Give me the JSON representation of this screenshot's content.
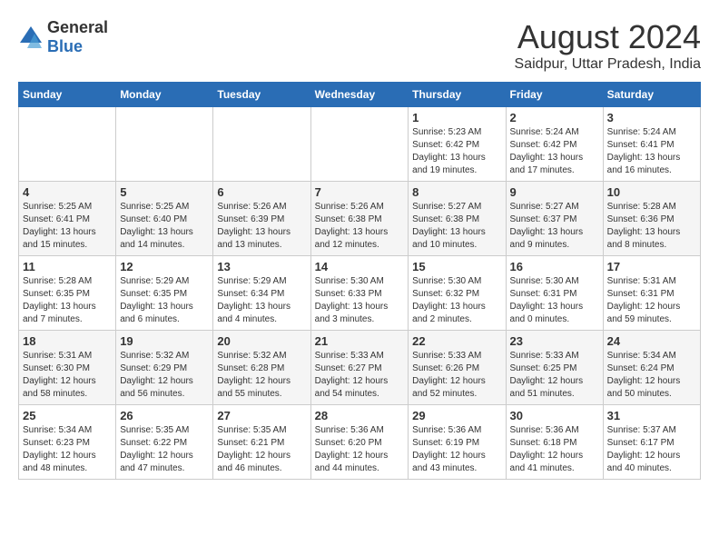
{
  "logo": {
    "text_general": "General",
    "text_blue": "Blue"
  },
  "title": "August 2024",
  "subtitle": "Saidpur, Uttar Pradesh, India",
  "weekdays": [
    "Sunday",
    "Monday",
    "Tuesday",
    "Wednesday",
    "Thursday",
    "Friday",
    "Saturday"
  ],
  "weeks": [
    [
      {
        "day": "",
        "info": ""
      },
      {
        "day": "",
        "info": ""
      },
      {
        "day": "",
        "info": ""
      },
      {
        "day": "",
        "info": ""
      },
      {
        "day": "1",
        "info": "Sunrise: 5:23 AM\nSunset: 6:42 PM\nDaylight: 13 hours\nand 19 minutes."
      },
      {
        "day": "2",
        "info": "Sunrise: 5:24 AM\nSunset: 6:42 PM\nDaylight: 13 hours\nand 17 minutes."
      },
      {
        "day": "3",
        "info": "Sunrise: 5:24 AM\nSunset: 6:41 PM\nDaylight: 13 hours\nand 16 minutes."
      }
    ],
    [
      {
        "day": "4",
        "info": "Sunrise: 5:25 AM\nSunset: 6:41 PM\nDaylight: 13 hours\nand 15 minutes."
      },
      {
        "day": "5",
        "info": "Sunrise: 5:25 AM\nSunset: 6:40 PM\nDaylight: 13 hours\nand 14 minutes."
      },
      {
        "day": "6",
        "info": "Sunrise: 5:26 AM\nSunset: 6:39 PM\nDaylight: 13 hours\nand 13 minutes."
      },
      {
        "day": "7",
        "info": "Sunrise: 5:26 AM\nSunset: 6:38 PM\nDaylight: 13 hours\nand 12 minutes."
      },
      {
        "day": "8",
        "info": "Sunrise: 5:27 AM\nSunset: 6:38 PM\nDaylight: 13 hours\nand 10 minutes."
      },
      {
        "day": "9",
        "info": "Sunrise: 5:27 AM\nSunset: 6:37 PM\nDaylight: 13 hours\nand 9 minutes."
      },
      {
        "day": "10",
        "info": "Sunrise: 5:28 AM\nSunset: 6:36 PM\nDaylight: 13 hours\nand 8 minutes."
      }
    ],
    [
      {
        "day": "11",
        "info": "Sunrise: 5:28 AM\nSunset: 6:35 PM\nDaylight: 13 hours\nand 7 minutes."
      },
      {
        "day": "12",
        "info": "Sunrise: 5:29 AM\nSunset: 6:35 PM\nDaylight: 13 hours\nand 6 minutes."
      },
      {
        "day": "13",
        "info": "Sunrise: 5:29 AM\nSunset: 6:34 PM\nDaylight: 13 hours\nand 4 minutes."
      },
      {
        "day": "14",
        "info": "Sunrise: 5:30 AM\nSunset: 6:33 PM\nDaylight: 13 hours\nand 3 minutes."
      },
      {
        "day": "15",
        "info": "Sunrise: 5:30 AM\nSunset: 6:32 PM\nDaylight: 13 hours\nand 2 minutes."
      },
      {
        "day": "16",
        "info": "Sunrise: 5:30 AM\nSunset: 6:31 PM\nDaylight: 13 hours\nand 0 minutes."
      },
      {
        "day": "17",
        "info": "Sunrise: 5:31 AM\nSunset: 6:31 PM\nDaylight: 12 hours\nand 59 minutes."
      }
    ],
    [
      {
        "day": "18",
        "info": "Sunrise: 5:31 AM\nSunset: 6:30 PM\nDaylight: 12 hours\nand 58 minutes."
      },
      {
        "day": "19",
        "info": "Sunrise: 5:32 AM\nSunset: 6:29 PM\nDaylight: 12 hours\nand 56 minutes."
      },
      {
        "day": "20",
        "info": "Sunrise: 5:32 AM\nSunset: 6:28 PM\nDaylight: 12 hours\nand 55 minutes."
      },
      {
        "day": "21",
        "info": "Sunrise: 5:33 AM\nSunset: 6:27 PM\nDaylight: 12 hours\nand 54 minutes."
      },
      {
        "day": "22",
        "info": "Sunrise: 5:33 AM\nSunset: 6:26 PM\nDaylight: 12 hours\nand 52 minutes."
      },
      {
        "day": "23",
        "info": "Sunrise: 5:33 AM\nSunset: 6:25 PM\nDaylight: 12 hours\nand 51 minutes."
      },
      {
        "day": "24",
        "info": "Sunrise: 5:34 AM\nSunset: 6:24 PM\nDaylight: 12 hours\nand 50 minutes."
      }
    ],
    [
      {
        "day": "25",
        "info": "Sunrise: 5:34 AM\nSunset: 6:23 PM\nDaylight: 12 hours\nand 48 minutes."
      },
      {
        "day": "26",
        "info": "Sunrise: 5:35 AM\nSunset: 6:22 PM\nDaylight: 12 hours\nand 47 minutes."
      },
      {
        "day": "27",
        "info": "Sunrise: 5:35 AM\nSunset: 6:21 PM\nDaylight: 12 hours\nand 46 minutes."
      },
      {
        "day": "28",
        "info": "Sunrise: 5:36 AM\nSunset: 6:20 PM\nDaylight: 12 hours\nand 44 minutes."
      },
      {
        "day": "29",
        "info": "Sunrise: 5:36 AM\nSunset: 6:19 PM\nDaylight: 12 hours\nand 43 minutes."
      },
      {
        "day": "30",
        "info": "Sunrise: 5:36 AM\nSunset: 6:18 PM\nDaylight: 12 hours\nand 41 minutes."
      },
      {
        "day": "31",
        "info": "Sunrise: 5:37 AM\nSunset: 6:17 PM\nDaylight: 12 hours\nand 40 minutes."
      }
    ]
  ]
}
